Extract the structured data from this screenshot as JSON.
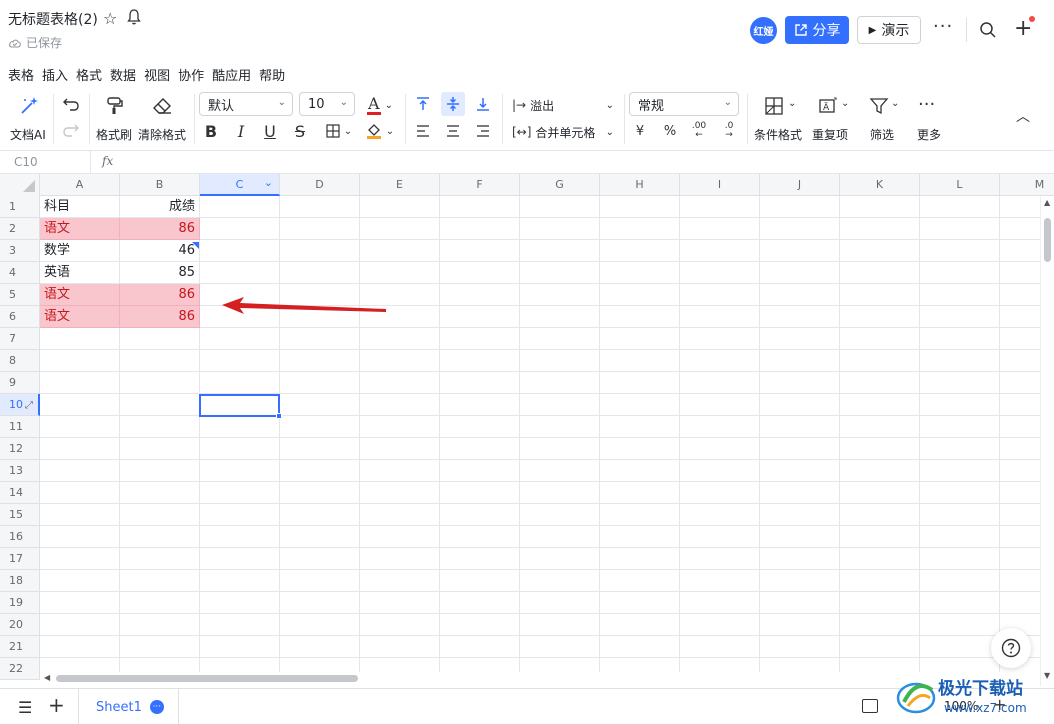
{
  "header": {
    "title": "无标题表格(2)",
    "saved_status": "已保存",
    "avatar": "红娅",
    "share_label": "分享",
    "present_label": "演示"
  },
  "menu": [
    "表格",
    "插入",
    "格式",
    "数据",
    "视图",
    "协作",
    "酷应用",
    "帮助"
  ],
  "toolbar": {
    "ai_label": "文档AI",
    "format_painter_label": "格式刷",
    "clear_format_label": "清除格式",
    "font_family": "默认",
    "font_size": "10",
    "overflow_label": "溢出",
    "merge_label": "合并单元格",
    "number_format": "常规",
    "currency_symbol": "¥",
    "percent_symbol": "%",
    "conditional_format_label": "条件格式",
    "duplicates_label": "重复项",
    "filter_label": "筛选",
    "more_label": "更多",
    "decimal_decrease": ".00",
    "decimal_increase": ".0"
  },
  "formula_bar": {
    "cell_ref": "C10",
    "fx": "fx"
  },
  "grid": {
    "columns": [
      "A",
      "B",
      "C",
      "D",
      "E",
      "F",
      "G",
      "H",
      "I",
      "J",
      "K",
      "L",
      "M"
    ],
    "rows": [
      "1",
      "2",
      "3",
      "4",
      "5",
      "6",
      "7",
      "8",
      "9",
      "10",
      "11",
      "12",
      "13",
      "14",
      "15",
      "16",
      "17",
      "18",
      "19",
      "20",
      "21",
      "22"
    ],
    "selected_cell": "C10",
    "data": [
      {
        "a": "科目",
        "b": "成绩",
        "highlight": false
      },
      {
        "a": "语文",
        "b": "86",
        "highlight": true
      },
      {
        "a": "数学",
        "b": "46",
        "highlight": false
      },
      {
        "a": "英语",
        "b": "85",
        "highlight": false
      },
      {
        "a": "语文",
        "b": "86",
        "highlight": true
      },
      {
        "a": "语文",
        "b": "86",
        "highlight": true
      }
    ]
  },
  "footer": {
    "sheet_name": "Sheet1",
    "zoom": "100%"
  },
  "watermark": {
    "text": "极光下载站",
    "url": "www.xz7.com"
  },
  "colors": {
    "accent": "#3370ff",
    "highlight_bg": "#fac6ce",
    "highlight_text": "#c7161c",
    "arrow": "#d42020"
  }
}
